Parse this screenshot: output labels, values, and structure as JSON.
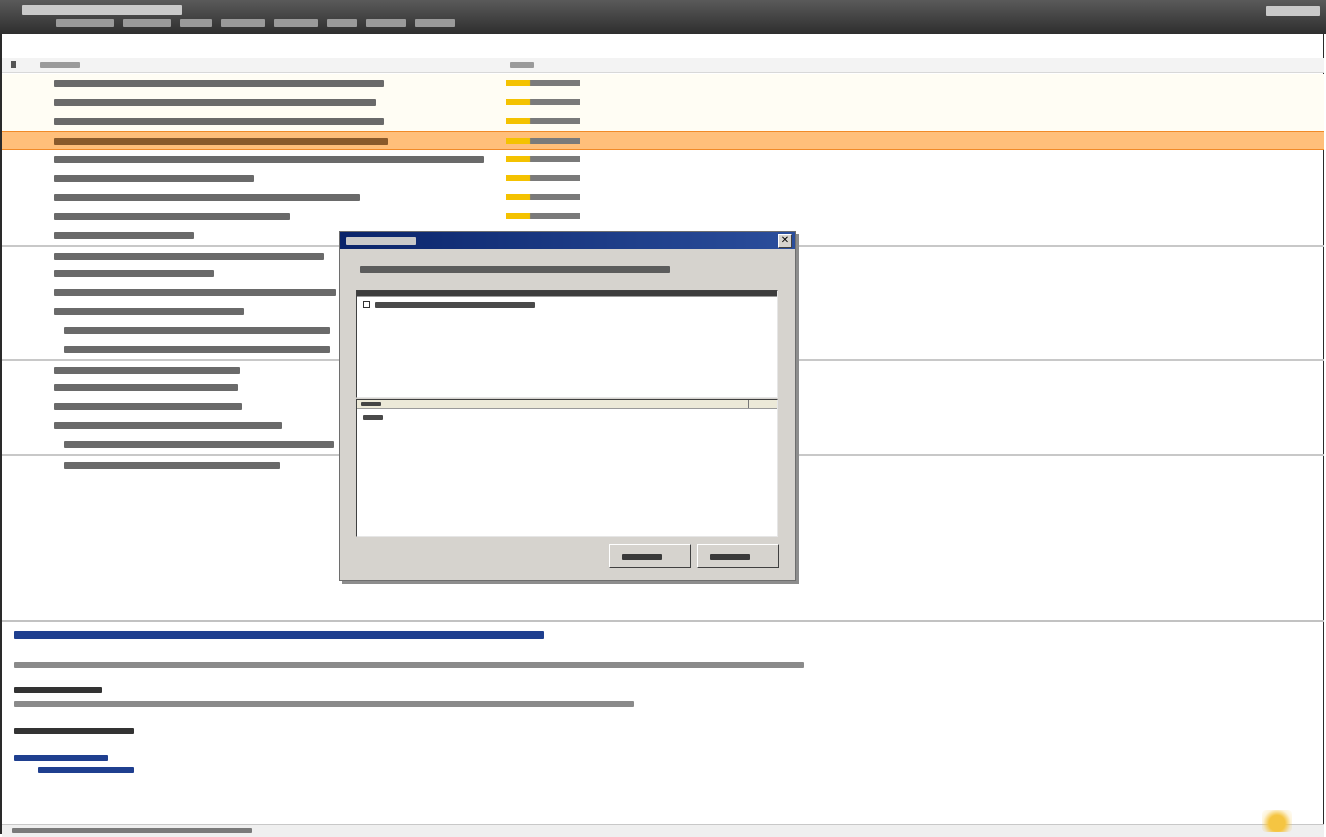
{
  "titlebar": {
    "title": "",
    "user": ""
  },
  "menu": {
    "items": [
      "",
      "",
      "",
      "",
      "",
      "",
      "",
      ""
    ]
  },
  "columns": {
    "name": "",
    "status": ""
  },
  "rows": [
    {
      "label": "",
      "status": ""
    },
    {
      "label": "",
      "status": ""
    },
    {
      "label": "",
      "status": ""
    },
    {
      "label": "",
      "status": ""
    },
    {
      "label": "",
      "status": ""
    },
    {
      "label": "",
      "status": ""
    },
    {
      "label": "",
      "status": ""
    },
    {
      "label": "",
      "status": ""
    },
    {
      "label": "",
      "status": ""
    },
    {
      "label": "",
      "status": ""
    },
    {
      "label": "",
      "status": ""
    },
    {
      "label": "",
      "status": ""
    },
    {
      "label": "",
      "status": ""
    },
    {
      "label": "",
      "status": ""
    },
    {
      "label": "",
      "status": ""
    },
    {
      "label": "",
      "status": ""
    },
    {
      "label": "",
      "status": ""
    },
    {
      "label": "",
      "status": ""
    },
    {
      "label": "",
      "status": ""
    },
    {
      "label": "",
      "status": ""
    },
    {
      "label": "",
      "status": ""
    }
  ],
  "selected_row": 3,
  "dialog": {
    "title": "",
    "prompt": "",
    "top_pane": {
      "header": "",
      "items": [
        ""
      ]
    },
    "bottom_pane": {
      "header": "",
      "items": [
        ""
      ]
    },
    "buttons": {
      "ok": "",
      "cancel": ""
    }
  },
  "detail": {
    "title": "",
    "lines": [
      "",
      "",
      "",
      "",
      "",
      ""
    ]
  },
  "statusbar": {
    "text": ""
  },
  "colors": {
    "titlebar": "#3a3a3a",
    "selection": "#ffbf7a",
    "dialog_title": "#0a246a",
    "link": "#1f3f8f",
    "status_fill": "#f4c200"
  }
}
